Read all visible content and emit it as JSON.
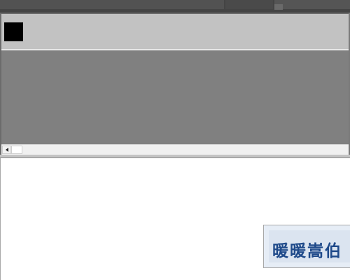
{
  "colors": {
    "top_strip": "#444444",
    "toolbar": "#c2c2c2",
    "workspace": "#808080",
    "lower_area": "#ffffff",
    "image_bg": "#e6edf6",
    "image_text": "#1f4a8a"
  },
  "toolbar": {
    "icon": "black-square-icon"
  },
  "scrollbar": {
    "left_arrow_icon": "chevron-left-icon"
  },
  "image": {
    "text": "暖暖嵩伯"
  }
}
